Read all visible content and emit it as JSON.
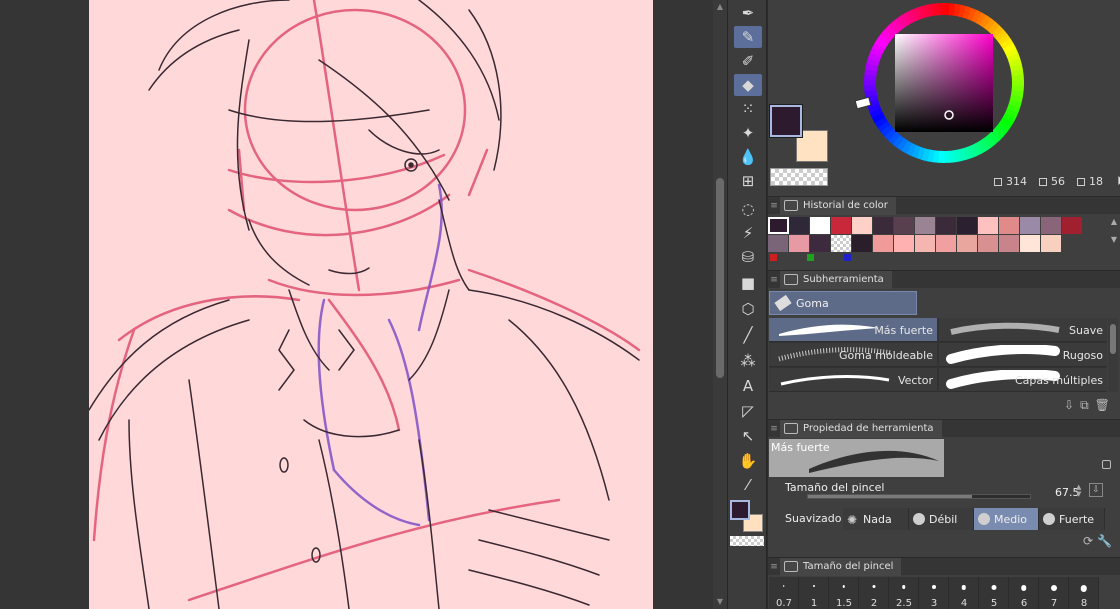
{
  "colors": {
    "main": "#2e1a2e",
    "sub": "#ffe2c2",
    "canvas_paper": "#ffd9d9",
    "accent": "#5d6b88"
  },
  "hsv": {
    "h": "314",
    "s": "56",
    "v": "18"
  },
  "sections": {
    "color_history": "Historial de color",
    "subtool": "Subherramienta",
    "tool_property": "Propiedad de herramienta",
    "brush_size": "Tamaño del pincel"
  },
  "toolbar_icons": [
    "pen-icon",
    "pencil-icon",
    "marker-icon",
    "eraser-icon",
    "airbrush-icon",
    "decoration-icon",
    "blend-icon",
    "3d-grid-icon",
    "lasso-icon",
    "magic-wand-icon",
    "fill-icon",
    "gradient-icon",
    "operation-icon",
    "line-icon",
    "frame-icon",
    "text-icon",
    "balloon-icon",
    "correct-line-icon",
    "hand-icon",
    "eyedropper-icon"
  ],
  "history": {
    "row1": [
      "#2e1a2e",
      "#2e2838",
      "#ffffff",
      "#c8283a",
      "#ffd0c8",
      "#3a2a3a",
      "#58404e",
      "#9a8494",
      "#3a2a3a",
      "#2a2030",
      "#ffc0c0",
      "#e08a8a",
      "#9a8aa8",
      "#8a6478",
      "#a02030"
    ],
    "row2": [
      "#7a6478",
      "#e89aa4",
      "#3e2a3e",
      "checker",
      "#2a1e2a",
      "#f09a9a",
      "#ffb0b0",
      "#f5b5b0",
      "#f0a0a0",
      "#e8a69e",
      "#d89090",
      "#c8848a",
      "#ffe4d8",
      "#f8d0c0"
    ],
    "dots": [
      "#cc2020",
      "#20a020",
      "#2020cc"
    ]
  },
  "subtool": {
    "group_label": "Goma",
    "brushes": [
      {
        "label": "Más fuerte",
        "selected": true
      },
      {
        "label": "Suave",
        "selected": false
      },
      {
        "label": "Goma moldeable",
        "selected": false
      },
      {
        "label": "Rugoso",
        "selected": false
      },
      {
        "label": "Vector",
        "selected": false
      },
      {
        "label": "Capas múltiples",
        "selected": false
      }
    ]
  },
  "property": {
    "preview_name": "Más fuerte",
    "size_label": "Tamaño del pincel",
    "size_value": "67.5",
    "size_fraction": 0.74,
    "smoothing_label": "Suavizado",
    "smoothing_options": [
      "Nada",
      "Débil",
      "Medio",
      "Fuerte"
    ],
    "smoothing_selected": "Medio"
  },
  "brush_sizes": [
    "0.7",
    "1",
    "1.5",
    "2",
    "2.5",
    "3",
    "4",
    "5",
    "6",
    "7",
    "8"
  ]
}
